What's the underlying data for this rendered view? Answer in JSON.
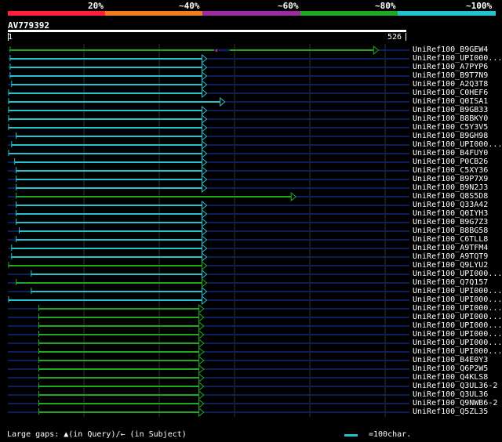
{
  "legend": {
    "labels": [
      "20%",
      "~40%",
      "~60%",
      "~80%",
      "~100%"
    ],
    "colors": [
      "#ff1e3c",
      "#f07d1e",
      "#9c2aa0",
      "#21a821",
      "#22c2cf"
    ]
  },
  "query": {
    "name": "AV779392",
    "start": "1",
    "end": "526",
    "length": 526
  },
  "hits": [
    {
      "label": "UniRef100_B9GEW4",
      "color": "#21a821",
      "start": 3,
      "end": 490,
      "gap": true
    },
    {
      "label": "UniRef100_UPI000...",
      "color": "#22c2cf",
      "start": 3,
      "end": 263
    },
    {
      "label": "UniRef100_A7PYP6",
      "color": "#22c2cf",
      "start": 3,
      "end": 263
    },
    {
      "label": "UniRef100_B9T7N9",
      "color": "#22c2cf",
      "start": 3,
      "end": 263
    },
    {
      "label": "UniRef100_A2Q3T8",
      "color": "#22c2cf",
      "start": 5,
      "end": 263
    },
    {
      "label": "UniRef100_C0HEF6",
      "color": "#22c2cf",
      "start": 1,
      "end": 263
    },
    {
      "label": "UniRef100_Q0ISA1",
      "color": "#22c2cf",
      "start": 1,
      "end": 287
    },
    {
      "label": "UniRef100_B9GB33",
      "color": "#22c2cf",
      "start": 1,
      "end": 263
    },
    {
      "label": "UniRef100_B8BKY0",
      "color": "#22c2cf",
      "start": 1,
      "end": 263
    },
    {
      "label": "UniRef100_C5Y3V5",
      "color": "#22c2cf",
      "start": 1,
      "end": 263
    },
    {
      "label": "UniRef100_B9GH98",
      "color": "#22c2cf",
      "start": 11,
      "end": 263
    },
    {
      "label": "UniRef100_UPI000...",
      "color": "#22c2cf",
      "start": 5,
      "end": 263
    },
    {
      "label": "UniRef100_B4FUY0",
      "color": "#22c2cf",
      "start": 1,
      "end": 263
    },
    {
      "label": "UniRef100_P0CB26",
      "color": "#22c2cf",
      "start": 9,
      "end": 263
    },
    {
      "label": "UniRef100_C5XY36",
      "color": "#22c2cf",
      "start": 11,
      "end": 263
    },
    {
      "label": "UniRef100_B9P7X9",
      "color": "#22c2cf",
      "start": 11,
      "end": 263
    },
    {
      "label": "UniRef100_B9N2J3",
      "color": "#22c2cf",
      "start": 11,
      "end": 263
    },
    {
      "label": "UniRef100_Q8S5D8",
      "color": "#21a821",
      "start": 11,
      "end": 381
    },
    {
      "label": "UniRef100_Q33A42",
      "color": "#22c2cf",
      "start": 11,
      "end": 263
    },
    {
      "label": "UniRef100_Q0IYH3",
      "color": "#22c2cf",
      "start": 11,
      "end": 263
    },
    {
      "label": "UniRef100_B9G7Z3",
      "color": "#22c2cf",
      "start": 11,
      "end": 263
    },
    {
      "label": "UniRef100_B8BG58",
      "color": "#22c2cf",
      "start": 15,
      "end": 263
    },
    {
      "label": "UniRef100_C6TLL8",
      "color": "#22c2cf",
      "start": 11,
      "end": 263
    },
    {
      "label": "UniRef100_A9TFM4",
      "color": "#22c2cf",
      "start": 5,
      "end": 263
    },
    {
      "label": "UniRef100_A9TQT9",
      "color": "#22c2cf",
      "start": 5,
      "end": 263
    },
    {
      "label": "UniRef100_Q9LYU2",
      "color": "#21a821",
      "start": 1,
      "end": 263
    },
    {
      "label": "UniRef100_UPI000...",
      "color": "#22c2cf",
      "start": 31,
      "end": 263
    },
    {
      "label": "UniRef100_Q7Q157",
      "color": "#21a821",
      "start": 11,
      "end": 263
    },
    {
      "label": "UniRef100_UPI000...",
      "color": "#22c2cf",
      "start": 31,
      "end": 263
    },
    {
      "label": "UniRef100_UPI000...",
      "color": "#22c2cf",
      "start": 1,
      "end": 263
    },
    {
      "label": "UniRef100_UPI000...",
      "color": "#21a821",
      "start": 41,
      "end": 259
    },
    {
      "label": "UniRef100_UPI000...",
      "color": "#21a821",
      "start": 41,
      "end": 259
    },
    {
      "label": "UniRef100_UPI000...",
      "color": "#21a821",
      "start": 41,
      "end": 259
    },
    {
      "label": "UniRef100_UPI000...",
      "color": "#21a821",
      "start": 41,
      "end": 259
    },
    {
      "label": "UniRef100_UPI000...",
      "color": "#21a821",
      "start": 41,
      "end": 259
    },
    {
      "label": "UniRef100_UPI000...",
      "color": "#21a821",
      "start": 41,
      "end": 259
    },
    {
      "label": "UniRef100_B4E0Y3",
      "color": "#21a821",
      "start": 41,
      "end": 259
    },
    {
      "label": "UniRef100_Q6P2W5",
      "color": "#21a821",
      "start": 41,
      "end": 259
    },
    {
      "label": "UniRef100_Q4KLS8",
      "color": "#21a821",
      "start": 41,
      "end": 259
    },
    {
      "label": "UniRef100_Q3UL36-2",
      "color": "#21a821",
      "start": 41,
      "end": 259
    },
    {
      "label": "UniRef100_Q3UL36",
      "color": "#21a821",
      "start": 41,
      "end": 259
    },
    {
      "label": "UniRef100_Q9NWB6-2",
      "color": "#21a821",
      "start": 41,
      "end": 259
    },
    {
      "label": "UniRef100_Q5ZL35",
      "color": "#21a821",
      "start": 41,
      "end": 259
    }
  ],
  "footer": {
    "gaps_text": "Large gaps: ▲(in Query)/← (in Subject)",
    "scale_text": "=100char."
  }
}
